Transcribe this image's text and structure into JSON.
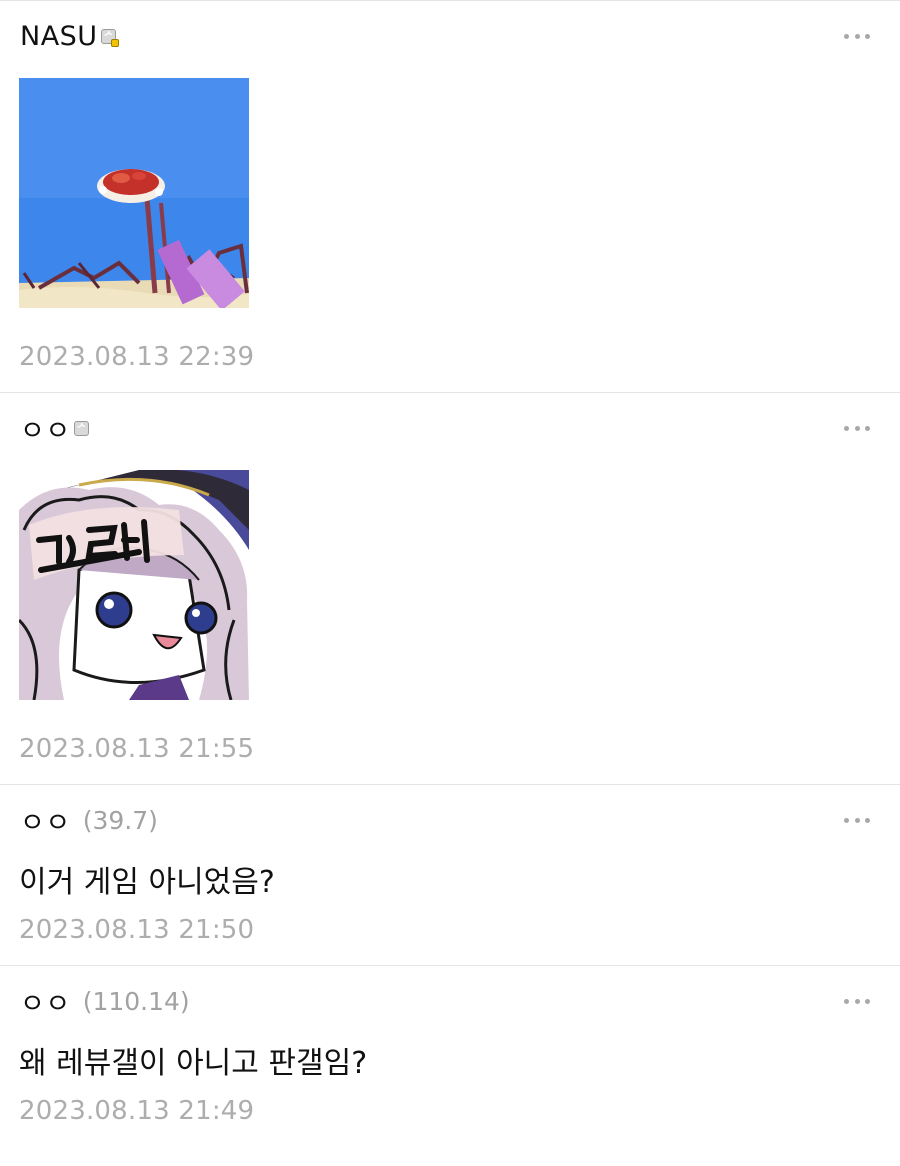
{
  "comments": [
    {
      "nickname": "NASU",
      "ip": "",
      "badge": "fixed-nick-icon",
      "content_type": "dccon",
      "dccon_alt": "",
      "timestamp": "2023.08.13 22:39",
      "more_icon": "more-horizontal-icon"
    },
    {
      "nickname": "ㅇㅇ",
      "ip": "",
      "badge": "half-fixed-nick-icon",
      "content_type": "dccon",
      "dccon_alt": "그래",
      "timestamp": "2023.08.13 21:55",
      "more_icon": "more-horizontal-icon"
    },
    {
      "nickname": "ㅇㅇ",
      "ip": "(39.7)",
      "content_type": "text",
      "text": "이거 게임 아니었음?",
      "timestamp": "2023.08.13 21:50",
      "more_icon": "more-horizontal-icon"
    },
    {
      "nickname": "ㅇㅇ",
      "ip": "(110.14)",
      "content_type": "text",
      "text": "왜 레뷰갤이 아니고 판갤임?",
      "timestamp": "2023.08.13 21:49",
      "more_icon": "more-horizontal-icon"
    }
  ],
  "colors": {
    "nickname": "#111111",
    "ip": "#a2a2a2",
    "timestamp": "#adadad",
    "divider": "#e4e4e4",
    "more_dots": "#a8a8a8",
    "badge_gold": "#f2c300"
  }
}
